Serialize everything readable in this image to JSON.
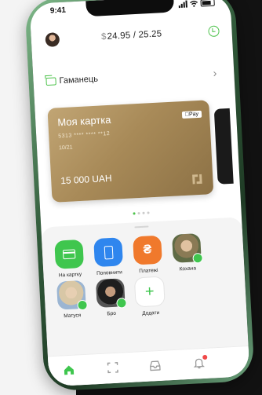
{
  "status_bar": {
    "time": "9:41"
  },
  "header": {
    "balance_symbol": "$",
    "balance_value": "24.95 / 25.25"
  },
  "wallet": {
    "label": "Гаманець",
    "chevron": "›"
  },
  "card": {
    "title": "Моя картка",
    "badge": "Pay",
    "number": "5313 **** **** **12",
    "expiry": "10/21",
    "amount": "15 000 UAH"
  },
  "quick_actions": [
    {
      "label": "На картку",
      "icon": "card-icon"
    },
    {
      "label": "Поповнити",
      "icon": "phone-icon"
    },
    {
      "label": "Платежі",
      "icon": "hryvnia-icon"
    },
    {
      "label": "Кохана",
      "icon": "contact-photo"
    },
    {
      "label": "Матуся",
      "icon": "contact-photo"
    },
    {
      "label": "Бро",
      "icon": "contact-photo"
    },
    {
      "label": "Додати",
      "icon": "plus-icon"
    }
  ],
  "colors": {
    "accent": "#3fc64e",
    "card_gold": "#a88a58",
    "action_blue": "#2f86ee",
    "action_orange": "#f0792c",
    "notification": "#f04a4a"
  },
  "tab_bar": {
    "items": [
      "home-icon",
      "scan-icon",
      "inbox-icon",
      "notifications-icon"
    ]
  }
}
